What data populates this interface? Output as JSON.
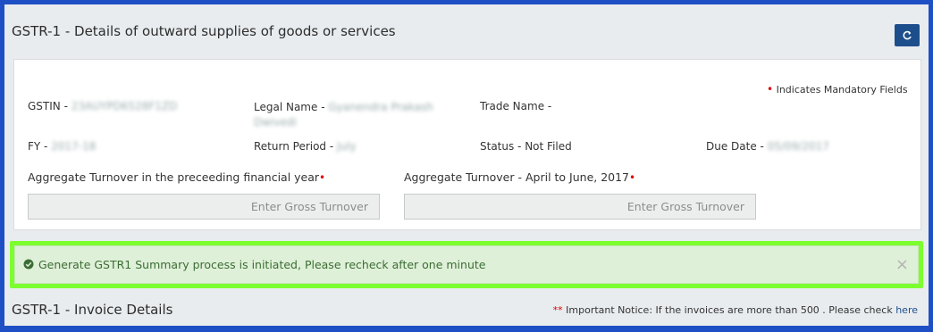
{
  "header": {
    "title": "GSTR-1 - Details of outward supplies of goods or services",
    "refresh_icon": "refresh-icon"
  },
  "details": {
    "mandatory_note": "Indicates Mandatory Fields",
    "gstin_label": "GSTIN -",
    "gstin_value": "23AUYPD6528F1ZD",
    "legal_name_label": "Legal Name -",
    "legal_name_value_line1": "Gyanendra Prakash",
    "legal_name_value_line2": "Dwivedi",
    "trade_name_label": "Trade Name -",
    "fy_label": "FY -",
    "fy_value": "2017-18",
    "return_period_label": "Return Period -",
    "return_period_value": "July",
    "status_label": "Status - Not Filed",
    "due_date_label": "Due Date -",
    "due_date_value": "05/09/2017",
    "turnover_prev_label": "Aggregate Turnover in the preceeding financial year",
    "turnover_prev_placeholder": "Enter Gross Turnover",
    "turnover_q1_label": "Aggregate Turnover - April to June, 2017",
    "turnover_q1_placeholder": "Enter Gross Turnover",
    "required_marker": "•"
  },
  "alert": {
    "message": "Generate GSTR1 Summary process is initiated, Please recheck after one minute",
    "close": "×",
    "colors": {
      "background": "#dff0d8",
      "text": "#3b6d34",
      "highlight": "#7cff2e"
    }
  },
  "invoice_section": {
    "title": "GSTR-1 - Invoice Details",
    "notice_stars": "**",
    "notice_text": "Important Notice: If the invoices are more than 500 . Please check",
    "notice_link": "here"
  }
}
